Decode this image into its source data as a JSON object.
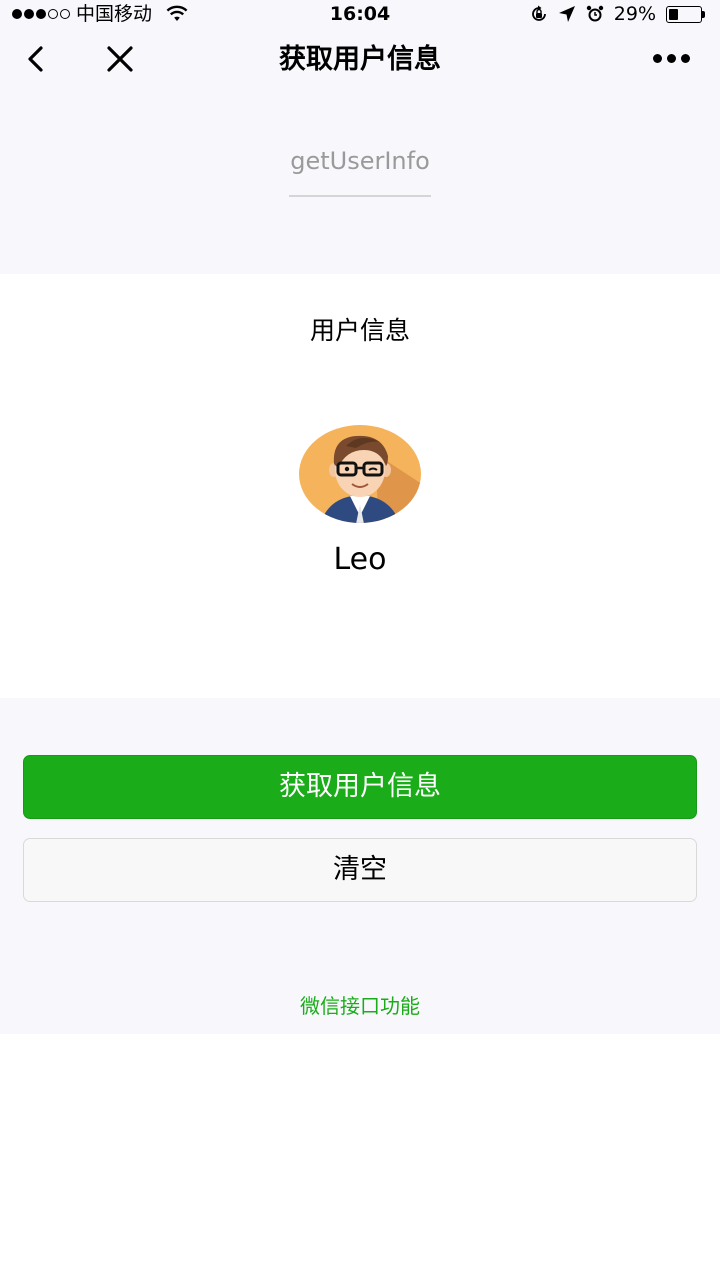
{
  "status_bar": {
    "carrier": "中国移动",
    "time": "16:04",
    "battery_percent": "29%",
    "battery_level": 0.29,
    "icons": [
      "signal-dots-icon",
      "wifi-icon",
      "rotation-lock-icon",
      "location-arrow-icon",
      "alarm-icon",
      "battery-icon"
    ]
  },
  "nav": {
    "title": "获取用户信息",
    "icons": [
      "back-icon",
      "close-icon",
      "more-icon"
    ]
  },
  "header": {
    "api_name": "getUserInfo"
  },
  "user_card": {
    "title": "用户信息",
    "nickname": "Leo",
    "avatar": "avatar-cartoon-man-glasses"
  },
  "buttons": {
    "get_user_info": "获取用户信息",
    "clear": "清空"
  },
  "footer": {
    "link": "微信接口功能"
  },
  "colors": {
    "primary_green": "#1aad19",
    "page_background": "#f8f7fc"
  }
}
